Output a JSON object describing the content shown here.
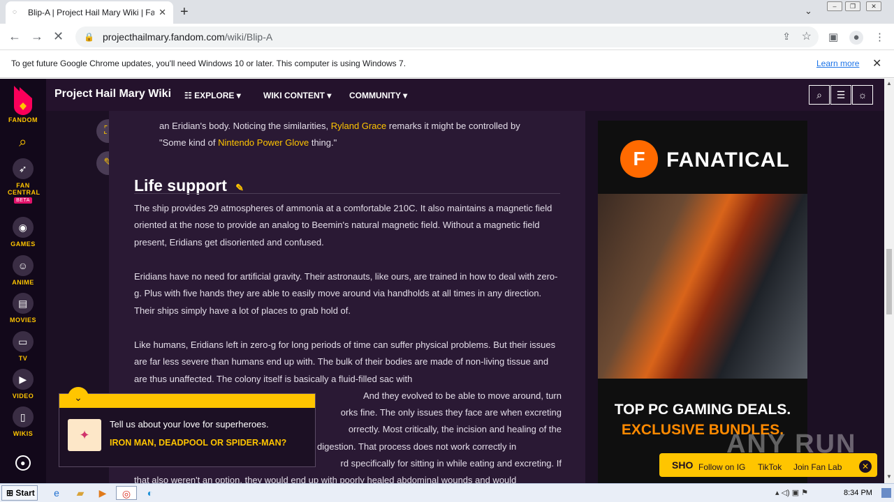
{
  "browser": {
    "tab_title": "Blip-A | Project Hail Mary Wiki | Fand",
    "url_domain": "projecthailmary.fandom.com",
    "url_path": "/wiki/Blip-A",
    "infobar_message": "To get future Google Chrome updates, you'll need Windows 10 or later. This computer is using Windows 7.",
    "infobar_link": "Learn more"
  },
  "rail": {
    "logo_label": "FANDOM",
    "items": [
      {
        "label": "FAN CENTRAL",
        "badge": "BETA",
        "icon": "rocket-icon"
      },
      {
        "label": "GAMES",
        "icon": "gamepad-icon"
      },
      {
        "label": "ANIME",
        "icon": "anime-icon"
      },
      {
        "label": "MOVIES",
        "icon": "clapper-icon"
      },
      {
        "label": "TV",
        "icon": "tv-icon"
      },
      {
        "label": "VIDEO",
        "icon": "play-icon"
      },
      {
        "label": "WIKIS",
        "icon": "book-icon"
      }
    ]
  },
  "header": {
    "wiki_name": "Project Hail Mary Wiki",
    "menus": [
      "EXPLORE",
      "WIKI CONTENT",
      "COMMUNITY"
    ]
  },
  "article": {
    "intro_pre": "an Eridian's body. Noticing the similarities,",
    "intro_link1": "Ryland Grace",
    "intro_mid": "remarks it might be controlled by",
    "intro_quote_pre": "\"Some kind of",
    "intro_link2": "Nintendo Power Glove",
    "intro_quote_post": "thing.\"",
    "heading": "Life support",
    "p1": "The ship provides 29 atmospheres of ammonia at a comfortable 210C. It also maintains a magnetic field oriented at the nose to provide an analog to Beemin's natural magnetic field. Without a magnetic field present, Eridians get disoriented and confused.",
    "p2": "Eridians have no need for artificial gravity. Their astronauts, like ours, are trained in how to deal with zero-g. Plus with five hands they are able to easily move around via handholds at all times in any direction. Their ships simply have a lot of places to grab hold of.",
    "p3": "Like humans, Eridians left in zero-g for long periods of time can suffer physical problems. But their issues are far less severe than humans end up with. The bulk of their bodies are made of non-living tissue and are thus unaffected. The colony itself is basically a fluid-filled sac with",
    "p3_line5_tail": "And they evolved to be able to move around, turn",
    "p3_line6_tail": "orks fine. The only issues they face are when excreting",
    "p3_line7_tail": "orrectly. Most critically, the incision and healing of the",
    "p3_line8_tail": "digestion. That process does not work correctly in",
    "p3_line9_tail": "rd specifically for sitting in while eating and excreting. If",
    "p3_line10": "that also weren't an option, they would end up with poorly healed abdominal wounds and would"
  },
  "ad": {
    "brand": "FANATICAL",
    "headline1": "TOP PC GAMING DEALS.",
    "headline2": "EXCLUSIVE BUNDLES."
  },
  "popup": {
    "question": "Tell us about your love for superheroes.",
    "answer": "IRON MAN, DEADPOOL OR SPIDER-MAN?"
  },
  "follow_bar": {
    "shop": "SHO",
    "links": [
      "Follow on IG",
      "TikTok",
      "Join Fan Lab"
    ]
  },
  "taskbar": {
    "start": "Start",
    "clock": "8:34 PM"
  },
  "watermark": "ANY RUN"
}
